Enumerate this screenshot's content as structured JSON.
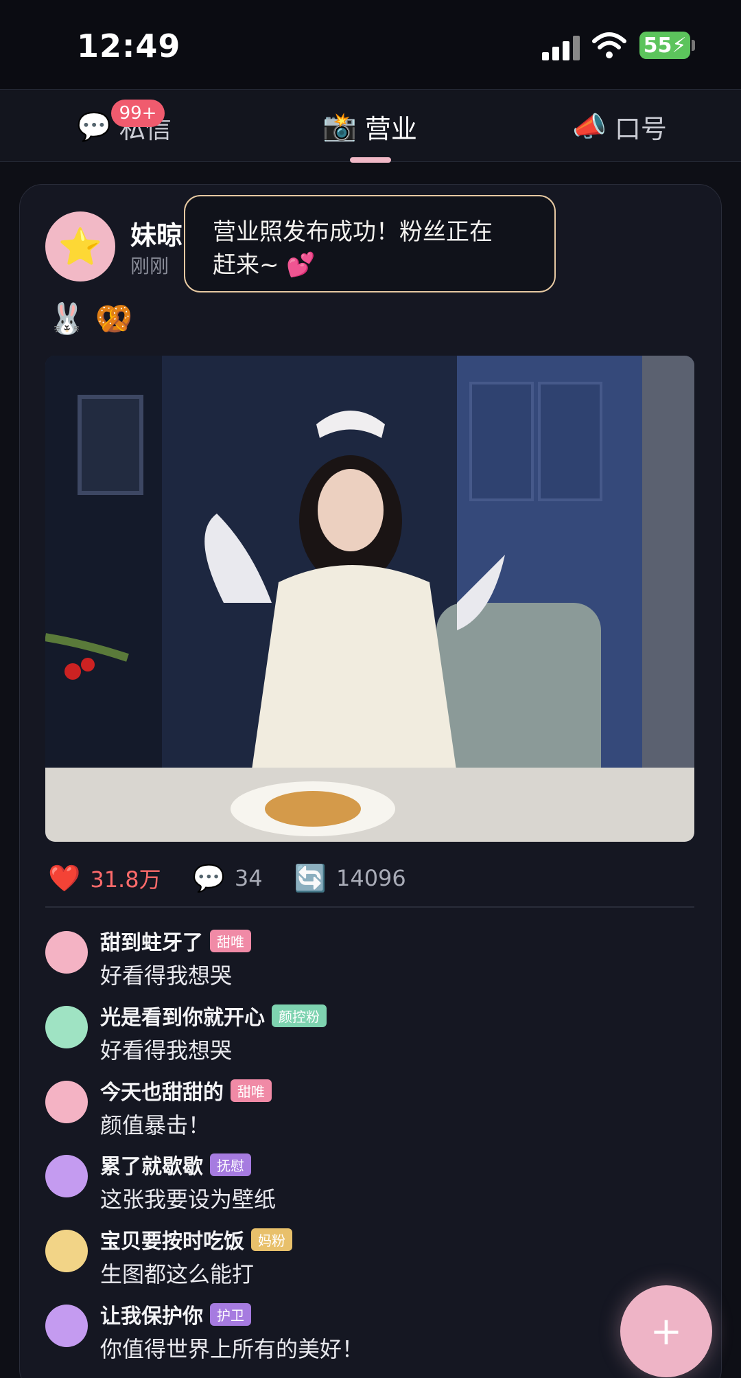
{
  "status_bar": {
    "time": "12:49",
    "battery": "55"
  },
  "tabs": [
    {
      "icon": "💬",
      "label": "私信",
      "badge": "99+"
    },
    {
      "icon": "📸",
      "label": "营业"
    },
    {
      "icon": "📣",
      "label": "口号"
    }
  ],
  "post": {
    "avatar_icon": "⭐",
    "username": "妹晾",
    "time": "刚刚",
    "toast_line1": "营业照发布成功！粉丝正在",
    "toast_line2": "赶来~ 💕",
    "emojis": "🐰 🥨",
    "stats": {
      "likes": "31.8万",
      "comments": "34",
      "shares": "14096"
    }
  },
  "comments": [
    {
      "name": "甜到蛀牙了",
      "tag": "甜唯",
      "text": "好看得我想哭",
      "avatar_color": "#f4b3c4",
      "tag_color": "#f08aa6"
    },
    {
      "name": "光是看到你就开心",
      "tag": "颜控粉",
      "text": "好看得我想哭",
      "avatar_color": "#9fe3c3",
      "tag_color": "#7ed3b0"
    },
    {
      "name": "今天也甜甜的",
      "tag": "甜唯",
      "text": "颜值暴击！",
      "avatar_color": "#f4b3c4",
      "tag_color": "#f08aa6"
    },
    {
      "name": "累了就歇歇",
      "tag": "抚慰",
      "text": "这张我要设为壁纸",
      "avatar_color": "#c49bf0",
      "tag_color": "#a67be0"
    },
    {
      "name": "宝贝要按时吃饭",
      "tag": "妈粉",
      "text": "生图都这么能打",
      "avatar_color": "#f2d487",
      "tag_color": "#e8c06b"
    },
    {
      "name": "让我保护你",
      "tag": "护卫",
      "text": "你值得世界上所有的美好！",
      "avatar_color": "#c49bf0",
      "tag_color": "#a67be0"
    }
  ],
  "fab": {
    "label": "+"
  }
}
